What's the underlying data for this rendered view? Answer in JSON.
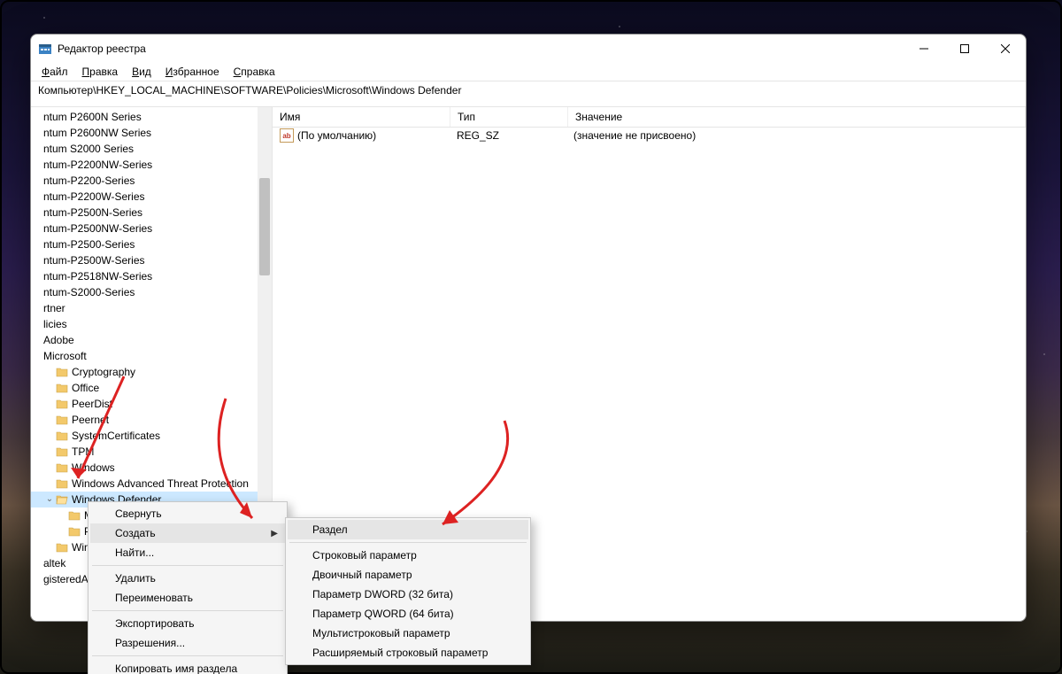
{
  "window": {
    "title": "Редактор реестра",
    "address": "Компьютер\\HKEY_LOCAL_MACHINE\\SOFTWARE\\Policies\\Microsoft\\Windows Defender"
  },
  "menu": {
    "file": "Файл",
    "edit": "Правка",
    "view": "Вид",
    "fav": "Избранное",
    "help": "Справка"
  },
  "tree": {
    "items": [
      {
        "label": "ntum P2600N Series",
        "indent": 0,
        "folder": false
      },
      {
        "label": "ntum P2600NW Series",
        "indent": 0,
        "folder": false
      },
      {
        "label": "ntum S2000 Series",
        "indent": 0,
        "folder": false
      },
      {
        "label": "ntum-P2200NW-Series",
        "indent": 0,
        "folder": false
      },
      {
        "label": "ntum-P2200-Series",
        "indent": 0,
        "folder": false
      },
      {
        "label": "ntum-P2200W-Series",
        "indent": 0,
        "folder": false
      },
      {
        "label": "ntum-P2500N-Series",
        "indent": 0,
        "folder": false
      },
      {
        "label": "ntum-P2500NW-Series",
        "indent": 0,
        "folder": false
      },
      {
        "label": "ntum-P2500-Series",
        "indent": 0,
        "folder": false
      },
      {
        "label": "ntum-P2500W-Series",
        "indent": 0,
        "folder": false
      },
      {
        "label": "ntum-P2518NW-Series",
        "indent": 0,
        "folder": false
      },
      {
        "label": "ntum-S2000-Series",
        "indent": 0,
        "folder": false
      },
      {
        "label": "rtner",
        "indent": 0,
        "folder": false
      },
      {
        "label": "licies",
        "indent": 0,
        "folder": false
      },
      {
        "label": "Adobe",
        "indent": 0,
        "folder": false
      },
      {
        "label": "Microsoft",
        "indent": 0,
        "folder": false
      },
      {
        "label": "Cryptography",
        "indent": 1,
        "folder": true
      },
      {
        "label": "Office",
        "indent": 1,
        "folder": true
      },
      {
        "label": "PeerDist",
        "indent": 1,
        "folder": true
      },
      {
        "label": "Peernet",
        "indent": 1,
        "folder": true
      },
      {
        "label": "SystemCertificates",
        "indent": 1,
        "folder": true
      },
      {
        "label": "TPM",
        "indent": 1,
        "folder": true
      },
      {
        "label": "Windows",
        "indent": 1,
        "folder": true
      },
      {
        "label": "Windows Advanced Threat Protection",
        "indent": 1,
        "folder": true
      },
      {
        "label": "Windows Defender",
        "indent": 1,
        "folder": true,
        "selected": true,
        "expander": "v"
      },
      {
        "label": "MpE",
        "indent": 2,
        "folder": true
      },
      {
        "label": "Poli",
        "indent": 2,
        "folder": true
      },
      {
        "label": "Windo",
        "indent": 1,
        "folder": true
      },
      {
        "label": "altek",
        "indent": 0,
        "folder": false
      },
      {
        "label": "gisteredAr",
        "indent": 0,
        "folder": false
      }
    ]
  },
  "columns": {
    "name": "Имя",
    "type": "Тип",
    "value": "Значение"
  },
  "row": {
    "icon": "ab",
    "name": "(По умолчанию)",
    "type": "REG_SZ",
    "value": "(значение не присвоено)"
  },
  "context_main": {
    "collapse": "Свернуть",
    "new": "Создать",
    "find": "Найти...",
    "delete": "Удалить",
    "rename": "Переименовать",
    "export": "Экспортировать",
    "perm": "Разрешения...",
    "copyname": "Копировать имя раздела"
  },
  "context_sub": {
    "key": "Раздел",
    "string": "Строковый параметр",
    "binary": "Двоичный параметр",
    "dword": "Параметр DWORD (32 бита)",
    "qword": "Параметр QWORD (64 бита)",
    "multi": "Мультистроковый параметр",
    "expand": "Расширяемый строковый параметр"
  }
}
